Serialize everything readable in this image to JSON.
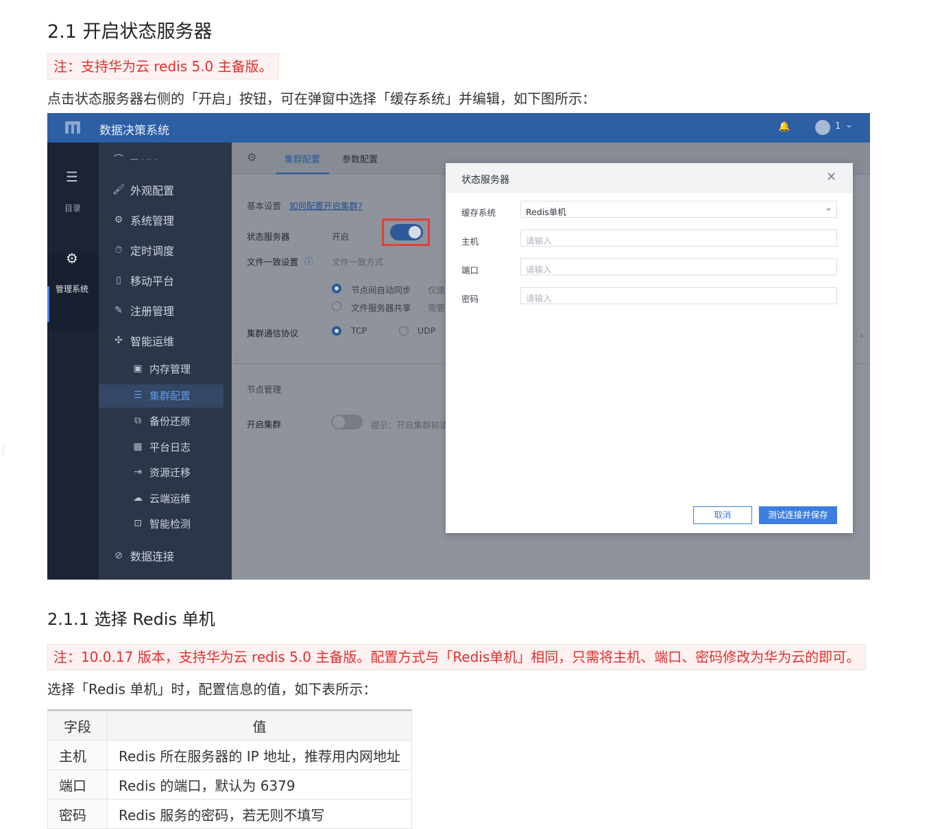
{
  "doc": {
    "h2": "2.1 开启状态服务器",
    "note1": "注：支持华为云 redis 5.0 主备版。",
    "para1": "点击状态服务器右侧的「开启」按钮，可在弹窗中选择「缓存系统」并编辑，如下图所示：",
    "h3": "2.1.1 选择 Redis 单机",
    "note2": "注：10.0.17 版本，支持华为云 redis 5.0 主备版。配置方式与「Redis单机」相同，只需将主机、端口、密码修改为华为云的即可。",
    "para2": "选择「Redis 单机」时，配置信息的值，如下表所示：",
    "table": {
      "headers": [
        "字段",
        "值"
      ],
      "rows": [
        [
          "主机",
          "Redis 所在服务器的 IP 地址，推荐用内网地址"
        ],
        [
          "端口",
          "Redis 的端口，默认为 6379"
        ],
        [
          "密码",
          "Redis 服务的密码，若无则不填写"
        ]
      ]
    }
  },
  "shot": {
    "app_title": "数据决策系统",
    "user_count": "1",
    "rail": {
      "catalog": "目录",
      "manage": "管理系统"
    },
    "menu": {
      "cut_item": "一 · ·· ·",
      "items": [
        "外观配置",
        "系统管理",
        "定时调度",
        "移动平台",
        "注册管理",
        "智能运维"
      ],
      "sub_items": [
        "内存管理",
        "集群配置",
        "备份还原",
        "平台日志",
        "资源迁移",
        "云端运维",
        "智能检测"
      ],
      "last": "数据连接"
    },
    "tabs": [
      "集群配置",
      "参数配置"
    ],
    "settings": {
      "basic_label": "基本设置",
      "basic_link": "如何配置开启集群?",
      "state_server": "状态服务器",
      "state_value": "开启",
      "file_consistency": "文件一致设置",
      "file_mode_placeholder": "文件一致方式",
      "option_sync": "节点间自动同步",
      "option_sync_hint": "仅建",
      "option_share": "文件服务器共享",
      "option_share_hint": "需要",
      "protocol_label": "集群通信协议",
      "tcp": "TCP",
      "udp": "UDP",
      "node_mgmt": "节点管理",
      "enable_cluster": "开启集群",
      "enable_hint": "提示：开启集群前请",
      "right_dot": "。"
    },
    "modal": {
      "title": "状态服务器",
      "cache_label": "缓存系统",
      "cache_value": "Redis单机",
      "host_label": "主机",
      "port_label": "端口",
      "pwd_label": "密码",
      "placeholder": "请输入",
      "cancel": "取消",
      "save": "测试连接并保存"
    }
  },
  "colors": {
    "accent": "#2c5fa4",
    "note_red": "#e0302d",
    "highlight_box": "#e2403a"
  }
}
